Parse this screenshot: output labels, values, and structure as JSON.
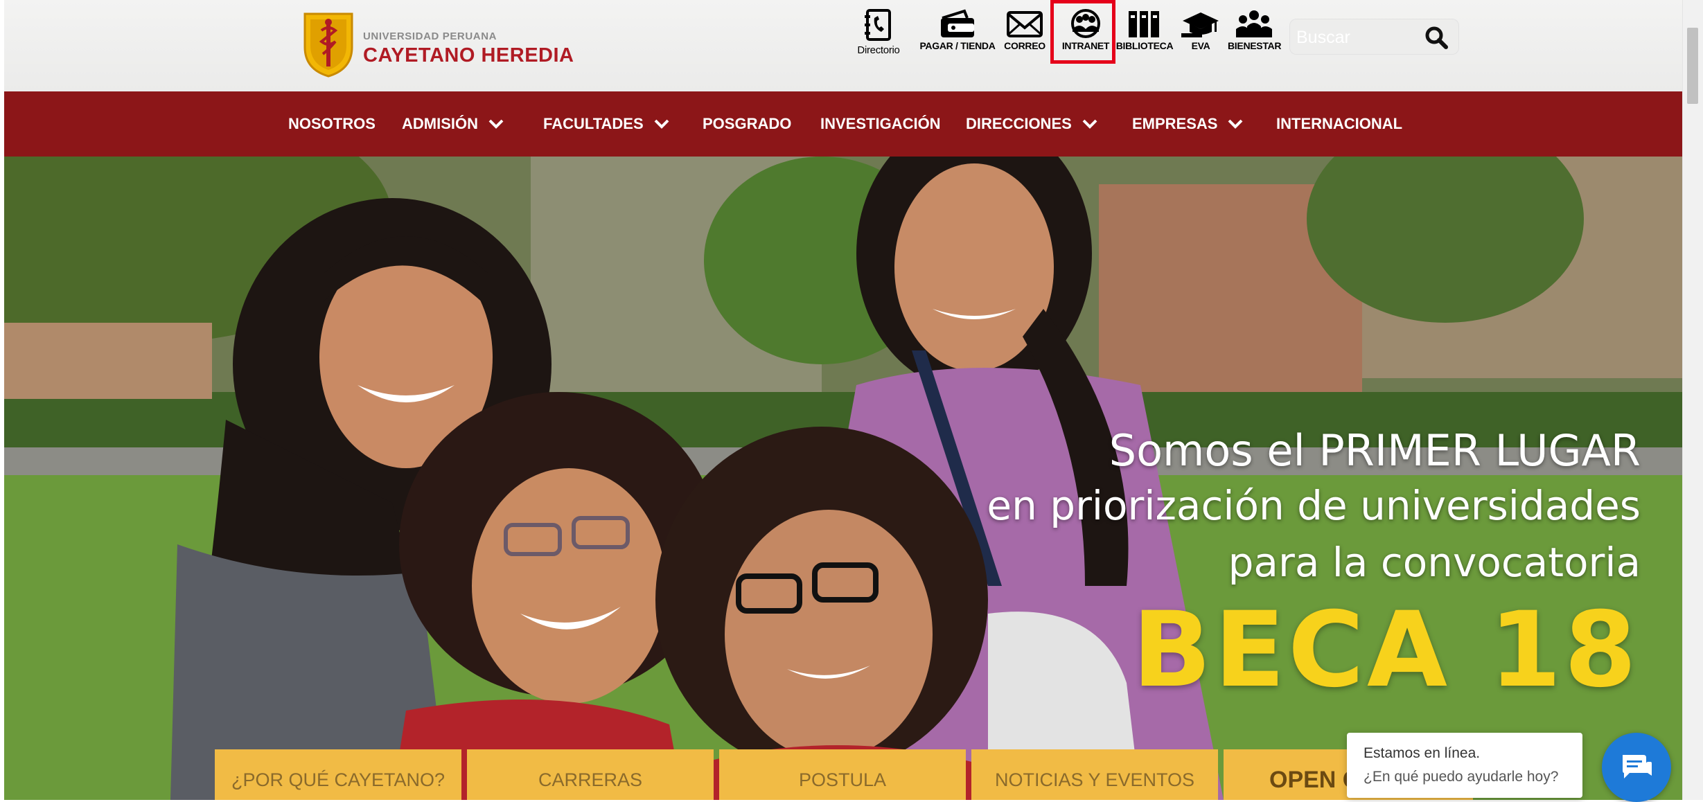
{
  "header": {
    "logo_small": "UNIVERSIDAD PERUANA",
    "logo_big": "CAYETANO HEREDIA",
    "tools": [
      {
        "label": "Directorio",
        "icon": "directory-icon"
      },
      {
        "label": "PAGAR / TIENDA",
        "icon": "wallet-icon"
      },
      {
        "label": "CORREO",
        "icon": "envelope-icon"
      },
      {
        "label": "INTRANET",
        "icon": "globe-users-icon",
        "highlighted": true
      },
      {
        "label": "BIBLIOTECA",
        "icon": "books-icon"
      },
      {
        "label": "EVA",
        "icon": "graduation-cap-icon"
      },
      {
        "label": "BIENESTAR",
        "icon": "group-icon"
      }
    ],
    "search": {
      "placeholder": "Buscar"
    }
  },
  "nav": {
    "items": [
      {
        "label": "NOSOTROS",
        "dropdown": false
      },
      {
        "label": "ADMISIÓN",
        "dropdown": true
      },
      {
        "label": "FACULTADES",
        "dropdown": true
      },
      {
        "label": "POSGRADO",
        "dropdown": false
      },
      {
        "label": "INVESTIGACIÓN",
        "dropdown": false
      },
      {
        "label": "DIRECCIONES",
        "dropdown": true
      },
      {
        "label": "EMPRESAS",
        "dropdown": true
      },
      {
        "label": "INTERNACIONAL",
        "dropdown": false
      }
    ]
  },
  "hero": {
    "line1": "Somos el PRIMER LUGAR",
    "line2": "en priorización de universidades",
    "line3": "para la convocatoria",
    "headline": "BECA 18"
  },
  "tabs": [
    {
      "label": "¿POR QUÉ CAYETANO?"
    },
    {
      "label": "CARRERAS"
    },
    {
      "label": "POSTULA"
    },
    {
      "label": "NOTICIAS Y EVENTOS"
    },
    {
      "label": "OPEN C"
    }
  ],
  "chat": {
    "line1": "Estamos en línea.",
    "line2": "¿En qué puedo ayudarle hoy?"
  },
  "colors": {
    "brand_red": "#8c1618",
    "logo_red": "#b01b24",
    "tab_yellow": "#f1bb45",
    "headline_yellow": "#f7d21c",
    "highlight_red": "#e5001a",
    "chat_blue": "#1e7ad8"
  }
}
